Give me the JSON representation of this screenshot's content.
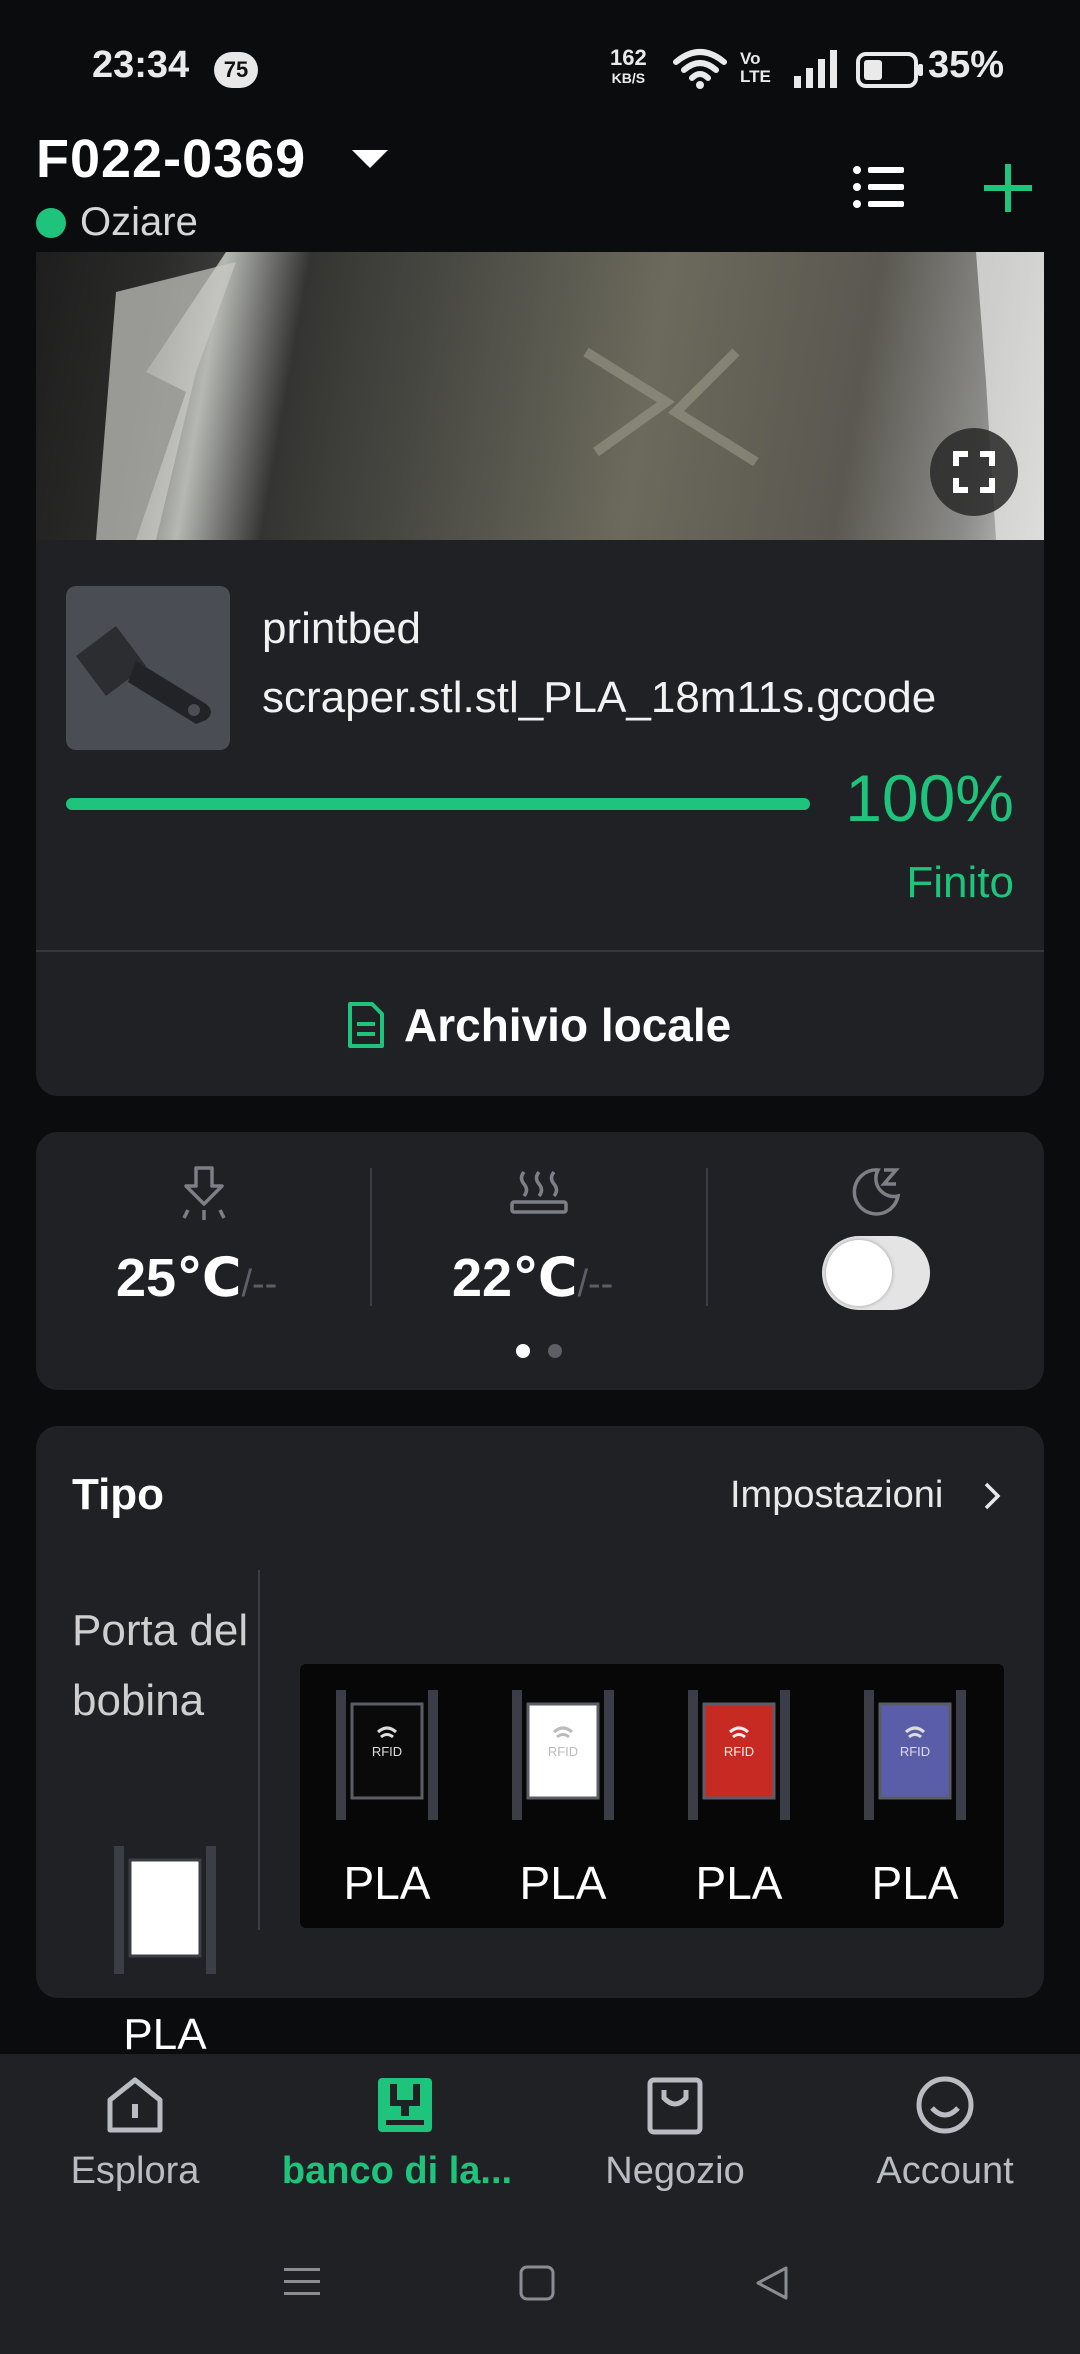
{
  "status_bar": {
    "time": "23:34",
    "notification_count": "75",
    "net_speed_value": "162",
    "net_speed_unit": "KB/S",
    "volte": "Vo LTE",
    "battery_percent": "35%"
  },
  "header": {
    "device_name": "F022-0369",
    "status": "Oziare",
    "status_color": "#1ec37c",
    "icons": [
      "list-icon",
      "plus-icon"
    ]
  },
  "camera": {
    "fullscreen_icon": "fullscreen-icon"
  },
  "job": {
    "file_name": "printbed scraper.stl.stl_PLA_18m11s.gcode",
    "progress": 1.0,
    "progress_label": "100%",
    "state": "Finito",
    "archive_label": "Archivio locale",
    "accent": "#1ec37c"
  },
  "temperatures": {
    "nozzle_value": "25℃",
    "nozzle_target": "/--",
    "bed_value": "22℃",
    "bed_target": "/--",
    "sleep_toggle_on": false,
    "page": 1,
    "pages": 2
  },
  "filament": {
    "title": "Tipo",
    "settings_label": "Impostazioni",
    "external_spool_label": "Porta del bobina",
    "external_spool": {
      "type": "PLA",
      "color": "#ffffff"
    },
    "ams_slots": [
      {
        "type": "PLA",
        "color": "#0a0a0a",
        "tag": "RFID"
      },
      {
        "type": "PLA",
        "color": "#ffffff",
        "tag": "RFID"
      },
      {
        "type": "PLA",
        "color": "#c62a22",
        "tag": "RFID"
      },
      {
        "type": "PLA",
        "color": "#5a5ea8",
        "tag": "RFID"
      }
    ]
  },
  "bottom_nav": {
    "items": [
      {
        "label": "Esplora",
        "icon": "home-icon"
      },
      {
        "label": "banco di la...",
        "icon": "workbench-icon",
        "active": true
      },
      {
        "label": "Negozio",
        "icon": "bag-icon"
      },
      {
        "label": "Account",
        "icon": "smile-icon"
      }
    ]
  }
}
